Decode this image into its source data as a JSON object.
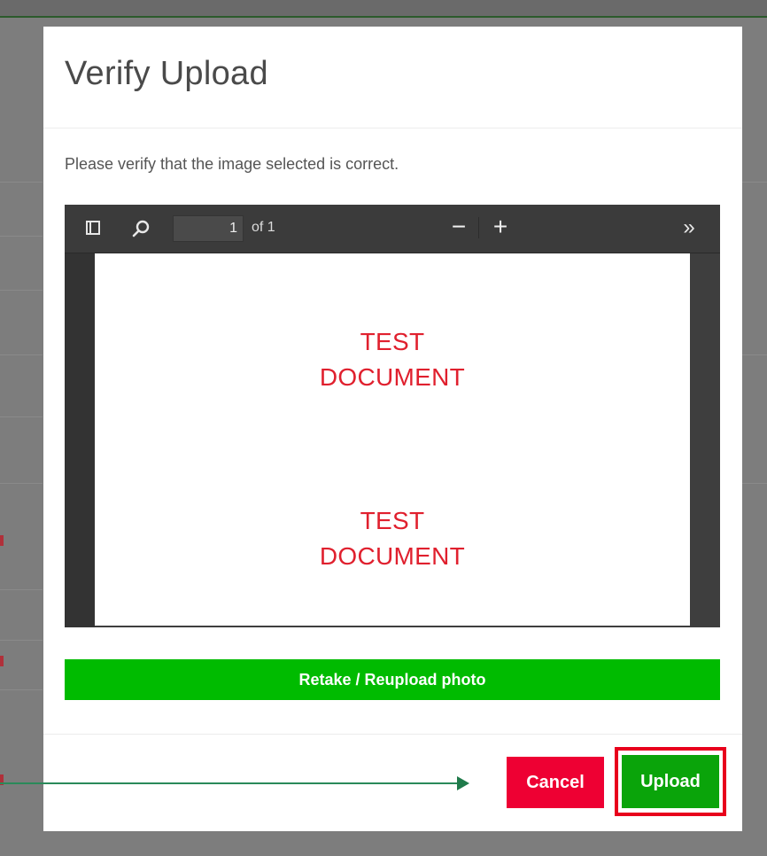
{
  "modal": {
    "title": "Verify Upload",
    "instructions": "Please verify that the image selected is correct."
  },
  "viewer": {
    "page_number": "1",
    "page_count_label": "of 1",
    "zoom_out_label": "−",
    "zoom_in_label": "+",
    "more_tools_label": "»",
    "document_lines": [
      [
        "TEST",
        "DOCUMENT"
      ],
      [
        "TEST",
        "DOCUMENT"
      ]
    ]
  },
  "actions": {
    "retake_label": "Retake / Reupload photo",
    "cancel_label": "Cancel",
    "upload_label": "Upload"
  },
  "colors": {
    "primary_green": "#00bb00",
    "upload_green": "#0aa40a",
    "cancel_red": "#ee0033",
    "highlight_red": "#e8001c",
    "document_text_red": "#e0202e"
  },
  "icons": {
    "sidebar": "sidebar-toggle-icon",
    "search": "search-icon",
    "more": "double-chevron-right-icon"
  }
}
